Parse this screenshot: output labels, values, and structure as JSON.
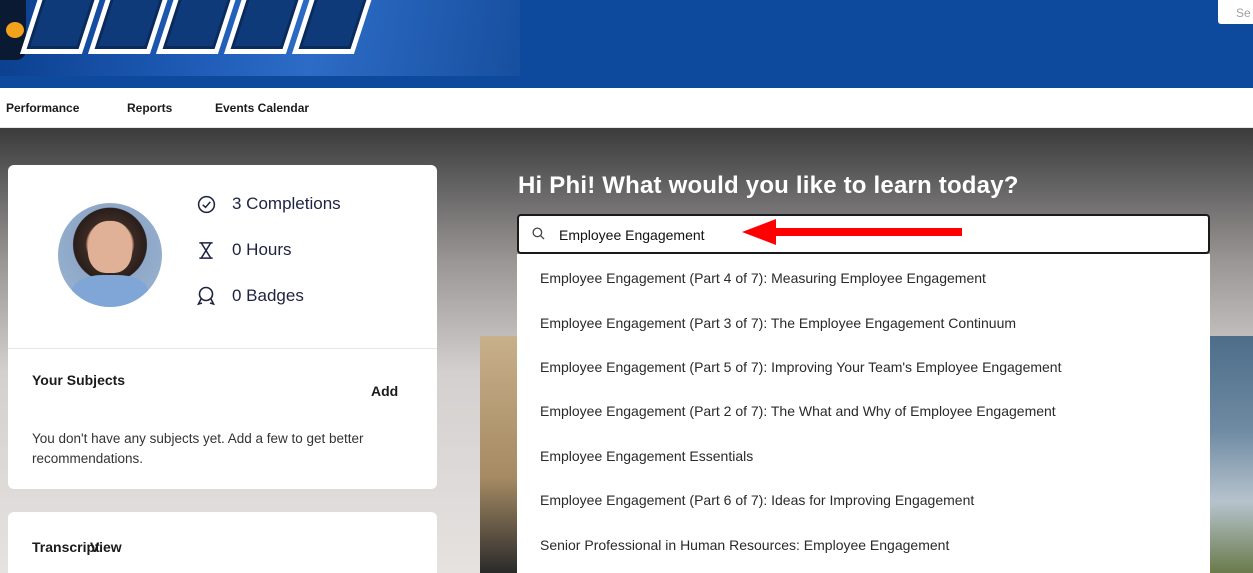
{
  "header": {
    "search_corner_text": "Se"
  },
  "nav": {
    "items": [
      "Performance",
      "Reports",
      "Events Calendar"
    ]
  },
  "profile": {
    "completions": "3 Completions",
    "hours": "0 Hours",
    "badges": "0 Badges"
  },
  "subjects": {
    "title": "Your Subjects",
    "add_label": "Add",
    "empty_text": "You don't have any subjects yet. Add a few to get better recommendations."
  },
  "transcript": {
    "label": "Transcript",
    "view_label": "View"
  },
  "greeting": "Hi Phi! What would you like to learn today?",
  "search": {
    "value": "Employee Engagement",
    "icon": "search-icon"
  },
  "annotation": {
    "arrow_color": "#ff0000"
  },
  "suggestions": [
    "Employee Engagement (Part 4 of 7): Measuring Employee Engagement",
    "Employee Engagement (Part 3 of 7): The Employee Engagement Continuum",
    "Employee Engagement (Part 5 of 7): Improving Your Team's Employee Engagement",
    "Employee Engagement (Part 2 of 7): The What and Why of Employee Engagement",
    "Employee Engagement Essentials",
    "Employee Engagement (Part 6 of 7): Ideas for Improving Engagement",
    "Senior Professional in Human Resources: Employee Engagement"
  ],
  "colors": {
    "banner": "#0d4a9e",
    "text_dark": "#1d2340"
  }
}
